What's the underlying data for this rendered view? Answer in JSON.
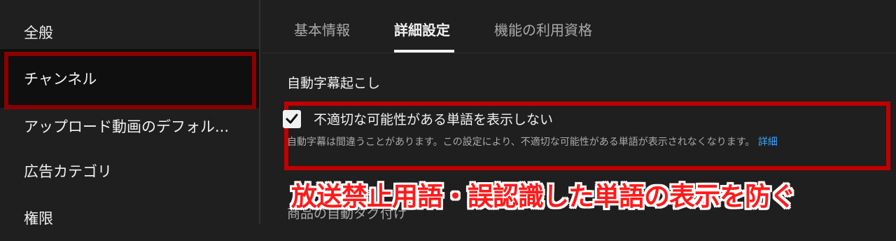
{
  "sidebar": {
    "items": [
      {
        "label": "全般"
      },
      {
        "label": "チャンネル"
      },
      {
        "label": "アップロード動画のデフォル..."
      },
      {
        "label": "広告カテゴリ"
      },
      {
        "label": "権限"
      }
    ]
  },
  "tabs": [
    {
      "label": "基本情報"
    },
    {
      "label": "詳細設定"
    },
    {
      "label": "機能の利用資格"
    }
  ],
  "auto_captions": {
    "title": "自動字幕起こし",
    "option_label": "不適切な可能性がある単語を表示しない",
    "option_checked": true,
    "description": "自動字幕は間違うことがあります。この設定により、不適切な可能性がある単語が表示されなくなります。",
    "detail_link": "詳細"
  },
  "next_section": {
    "title": "商品の自動タグ付け"
  },
  "overlay": {
    "caption": "放送禁止用語・誤認識した単語の表示を防ぐ"
  },
  "colors": {
    "highlight_sidebar": "#8b0000",
    "highlight_option": "#c00000",
    "caption_text": "#ff1a1a",
    "link": "#3ea6ff"
  }
}
